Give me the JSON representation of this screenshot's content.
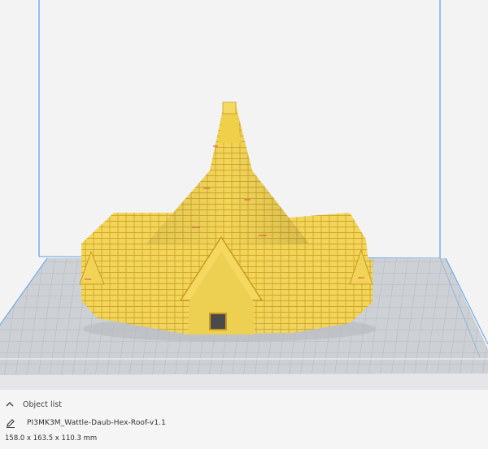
{
  "object_list": {
    "header_label": "Object list",
    "object_name": "PI3MK3M_Wattle-Daub-Hex-Roof-v1.1",
    "dimensions": "158.0 x 163.5 x 110.3 mm"
  },
  "icons": {
    "collapse": "chevron-up-icon",
    "edit": "pencil-icon"
  },
  "colors": {
    "model": "#f2d65a",
    "model_shadow": "#d9ad2a",
    "build_volume_edge": "#5aa0e8",
    "build_plate": "#c9cbd0",
    "overhang": "#d94040"
  }
}
